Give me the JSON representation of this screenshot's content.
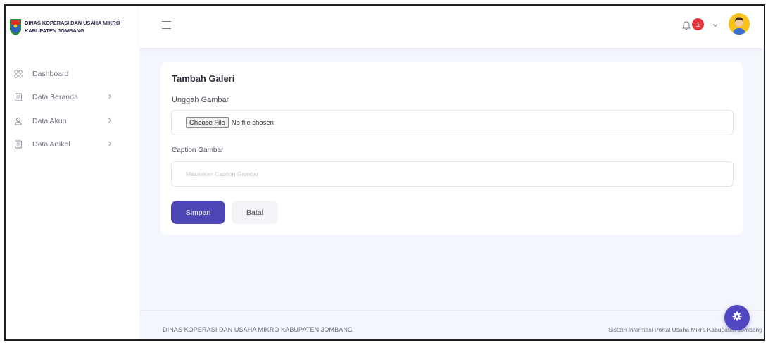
{
  "brand": {
    "line1": "DINAS KOPERASI DAN USAHA MIKRO",
    "line2": "KABUPATEN JOMBANG"
  },
  "header": {
    "notification_count": "1",
    "menu_icon": "hamburger-icon",
    "bell_icon": "bell-icon",
    "caret_icon": "chevron-down-icon"
  },
  "sidebar": {
    "items": [
      {
        "label": "Dashboard",
        "icon": "grid-icon",
        "has_submenu": false
      },
      {
        "label": "Data Beranda",
        "icon": "document-icon",
        "has_submenu": true
      },
      {
        "label": "Data Akun",
        "icon": "user-icon",
        "has_submenu": true
      },
      {
        "label": "Data Artikel",
        "icon": "document-icon",
        "has_submenu": true
      }
    ]
  },
  "form": {
    "title": "Tambah Galeri",
    "upload_label": "Unggah Gambar",
    "file_button": "Choose File",
    "file_status": "No file chosen",
    "caption_label": "Caption Gambar",
    "caption_placeholder": "Masukkan Caption Gambar",
    "caption_value": "",
    "save_label": "Simpan",
    "cancel_label": "Batal"
  },
  "footer": {
    "left": "DINAS KOPERASI DAN USAHA MIKRO KABUPATEN JOMBANG",
    "right": "Sistem Informasi Portal Usaha Mikro Kabupaten Jombang"
  },
  "colors": {
    "primary": "#4f46b5",
    "badge": "#e5333a",
    "background": "#f3f6fd",
    "avatar": "#f7c31a"
  }
}
